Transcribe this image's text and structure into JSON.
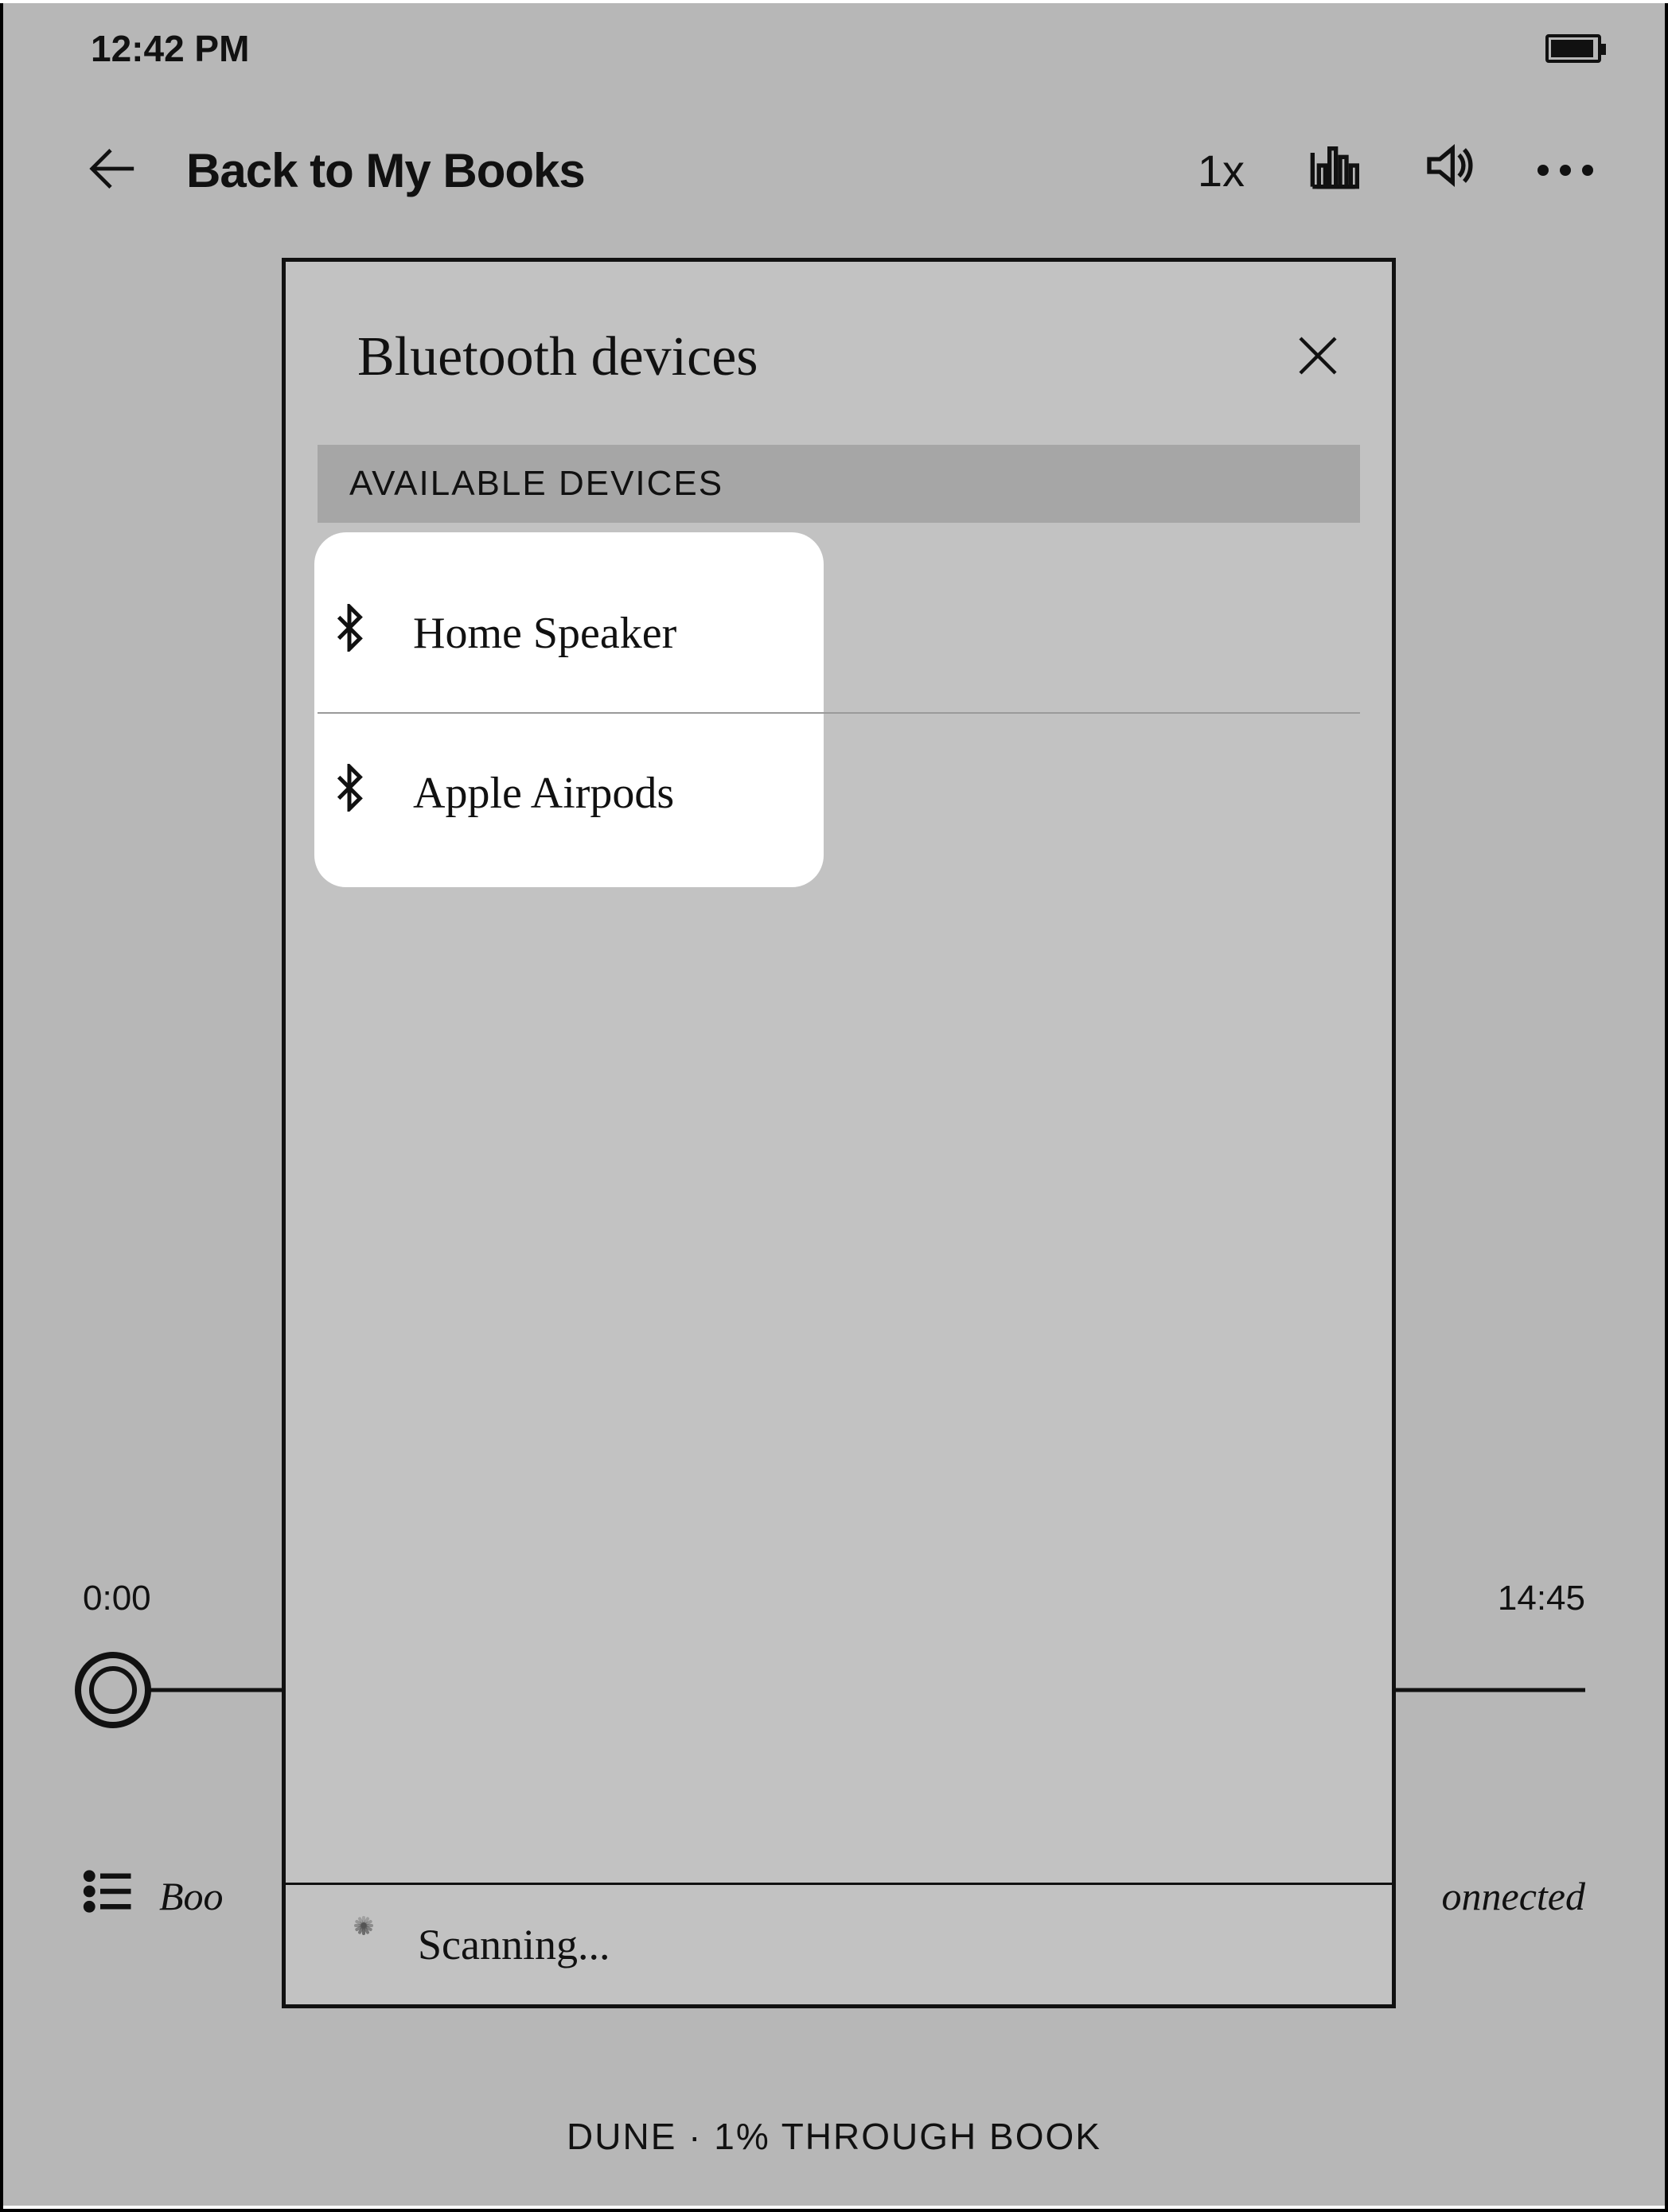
{
  "statusbar": {
    "time": "12:42 PM"
  },
  "toolbar": {
    "back_label": "Back to My Books",
    "speed": "1x"
  },
  "time": {
    "elapsed": "0:00",
    "total": "14:45"
  },
  "bookmark": {
    "left": "Boo",
    "right": "onnected"
  },
  "footer": {
    "text": "DUNE · 1% THROUGH BOOK"
  },
  "modal": {
    "title": "Bluetooth devices",
    "section": "AVAILABLE DEVICES",
    "devices": [
      {
        "name": "Home Speaker"
      },
      {
        "name": "Apple Airpods"
      }
    ],
    "status": "Scanning..."
  }
}
